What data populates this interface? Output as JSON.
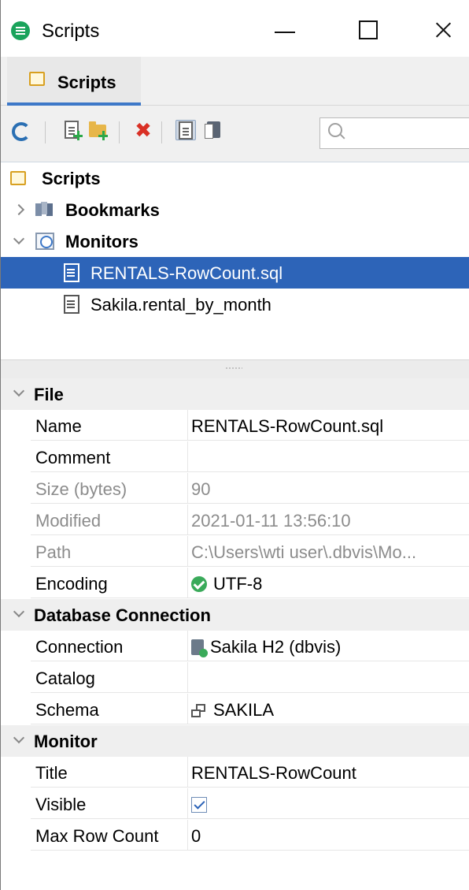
{
  "window": {
    "title": "Scripts"
  },
  "tabs": [
    {
      "label": "Scripts",
      "active": true
    }
  ],
  "toolbar": {
    "buttons": [
      "refresh-icon",
      "new-script-icon",
      "new-folder-icon",
      "delete-icon",
      "search-scripts-icon",
      "bookmarks-view-icon"
    ],
    "search_placeholder": ""
  },
  "tree": {
    "root": "Scripts",
    "nodes": [
      {
        "label": "Bookmarks",
        "expanded": false
      },
      {
        "label": "Monitors",
        "expanded": true
      },
      {
        "label": "RENTALS-RowCount.sql",
        "selected": true
      },
      {
        "label": "Sakila.rental_by_month",
        "selected": false
      }
    ]
  },
  "props": {
    "sections": [
      {
        "label": "File"
      },
      {
        "label": "Database Connection"
      },
      {
        "label": "Monitor"
      }
    ],
    "file": {
      "name": {
        "label": "Name",
        "value": "RENTALS-RowCount.sql"
      },
      "comment": {
        "label": "Comment",
        "value": ""
      },
      "size": {
        "label": "Size (bytes)",
        "value": "90"
      },
      "modified": {
        "label": "Modified",
        "value": "2021-01-11 13:56:10"
      },
      "path": {
        "label": "Path",
        "value": "C:\\Users\\wti user\\.dbvis\\Mo..."
      },
      "encoding": {
        "label": "Encoding",
        "value": "UTF-8"
      }
    },
    "database": {
      "connection": {
        "label": "Connection",
        "value": "Sakila H2 (dbvis)"
      },
      "catalog": {
        "label": "Catalog",
        "value": ""
      },
      "schema": {
        "label": "Schema",
        "value": "SAKILA"
      }
    },
    "monitor": {
      "title": {
        "label": "Title",
        "value": "RENTALS-RowCount"
      },
      "visible": {
        "label": "Visible",
        "checked": true
      },
      "max_row_count": {
        "label": "Max Row Count",
        "value": "0"
      }
    }
  },
  "colors": {
    "selection": "#2d64b8",
    "tab_underline": "#3d78c8",
    "section_bg": "#efefef",
    "app_icon": "#1aa35b"
  }
}
